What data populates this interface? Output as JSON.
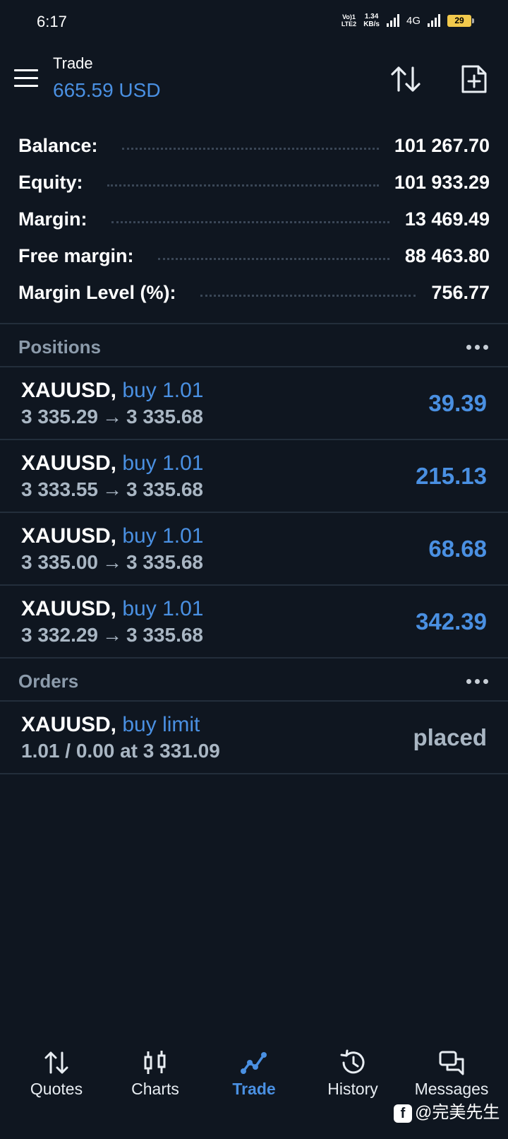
{
  "status_bar": {
    "time": "6:17",
    "volte": "Vo)) 1\nLTE2",
    "speed_value": "1.34",
    "speed_unit": "KB/s",
    "network": "4G",
    "battery": "29"
  },
  "header": {
    "title": "Trade",
    "subtitle": "665.59 USD"
  },
  "summary": [
    {
      "label": "Balance:",
      "value": "101 267.70"
    },
    {
      "label": "Equity:",
      "value": "101 933.29"
    },
    {
      "label": "Margin:",
      "value": "13 469.49"
    },
    {
      "label": "Free margin:",
      "value": "88 463.80"
    },
    {
      "label": "Margin Level (%):",
      "value": "756.77"
    }
  ],
  "positions": {
    "label": "Positions",
    "items": [
      {
        "symbol": "XAUUSD,",
        "side": "buy 1.01",
        "open": "3 335.29",
        "arrow": "→",
        "current": "3 335.68",
        "profit": "39.39"
      },
      {
        "symbol": "XAUUSD,",
        "side": "buy 1.01",
        "open": "3 333.55",
        "arrow": "→",
        "current": "3 335.68",
        "profit": "215.13"
      },
      {
        "symbol": "XAUUSD,",
        "side": "buy 1.01",
        "open": "3 335.00",
        "arrow": "→",
        "current": "3 335.68",
        "profit": "68.68"
      },
      {
        "symbol": "XAUUSD,",
        "side": "buy 1.01",
        "open": "3 332.29",
        "arrow": "→",
        "current": "3 335.68",
        "profit": "342.39"
      }
    ]
  },
  "orders": {
    "label": "Orders",
    "items": [
      {
        "symbol": "XAUUSD,",
        "side": "buy limit",
        "detail": "1.01 / 0.00 at 3 331.09",
        "status": "placed"
      }
    ]
  },
  "bottom_nav": [
    {
      "label": "Quotes",
      "icon": "quotes-icon"
    },
    {
      "label": "Charts",
      "icon": "charts-icon"
    },
    {
      "label": "Trade",
      "icon": "trade-icon",
      "active": true
    },
    {
      "label": "History",
      "icon": "history-icon"
    },
    {
      "label": "Messages",
      "icon": "messages-icon"
    }
  ],
  "watermark": "@完美先生",
  "colors": {
    "background": "#0f1620",
    "accent": "#4a90e2",
    "muted": "#a9b6c3",
    "section": "#8c9bab"
  }
}
